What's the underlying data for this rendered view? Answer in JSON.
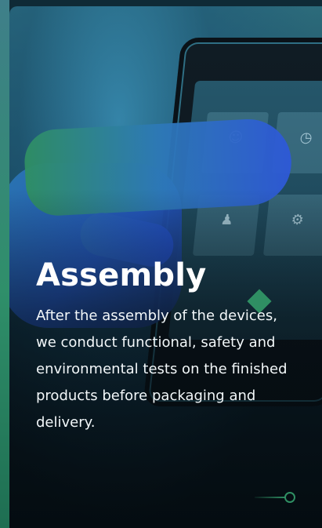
{
  "card": {
    "title": "Assembly",
    "description": "After the assembly of the devices, we conduct functional, safety and environmental tests on the finished products before packaging and delivery."
  },
  "colors": {
    "accent_green": "#2f8f63",
    "text": "#ffffff"
  },
  "icons": {
    "decor": "diamond-icon",
    "indicator": "slide-indicator-icon"
  }
}
